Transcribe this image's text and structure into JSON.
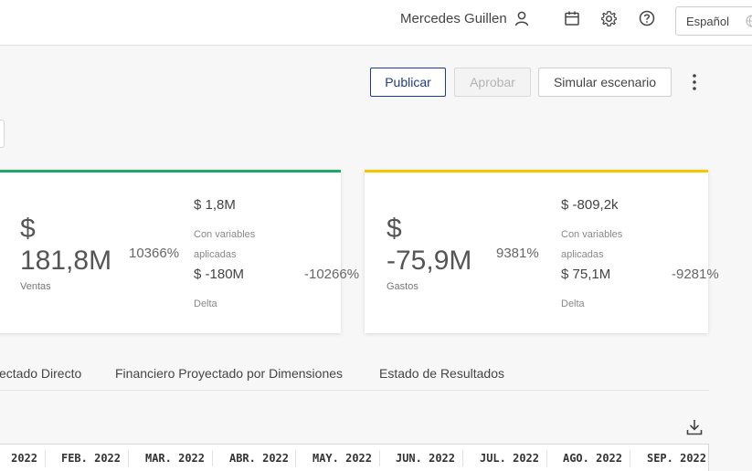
{
  "header": {
    "user_name": "Mercedes Guillen",
    "language": "Español",
    "icons": [
      "user-icon",
      "calendar-icon",
      "gear-icon",
      "help-icon",
      "globe-icon"
    ]
  },
  "actions": {
    "publish_label": "Publicar",
    "approve_label": "Aprobar",
    "simulate_label": "Simular escenario",
    "more_icon": "more-vert-icon"
  },
  "cards": {
    "sales": {
      "currency": "$",
      "value": "181,8M",
      "label": "Ventas",
      "pct": "10366%",
      "variables_value": "$ 1,8M",
      "variables_label": "Con variables aplicadas",
      "delta_value": "$ -180M",
      "delta_label": "Delta",
      "delta_pct": "-10266%",
      "accent": "#1ea66b"
    },
    "expenses": {
      "currency": "$",
      "value": "-75,9M",
      "label": "Gastos",
      "pct": "9381%",
      "variables_value": "$ -809,2k",
      "variables_label": "Con variables aplicadas",
      "delta_value": "$ 75,1M",
      "delta_label": "Delta",
      "delta_pct": "-9281%",
      "accent": "#f3c800"
    }
  },
  "tabs": [
    {
      "label": "ectado Directo"
    },
    {
      "label": "Financiero Proyectado por Dimensiones"
    },
    {
      "label": "Estado de Resultados"
    }
  ],
  "table": {
    "download_icon": "download-icon",
    "months": [
      "2022",
      "FEB. 2022",
      "MAR. 2022",
      "ABR. 2022",
      "MAY. 2022",
      "JUN. 2022",
      "JUL. 2022",
      "AGO. 2022",
      "SEP. 2022"
    ]
  }
}
